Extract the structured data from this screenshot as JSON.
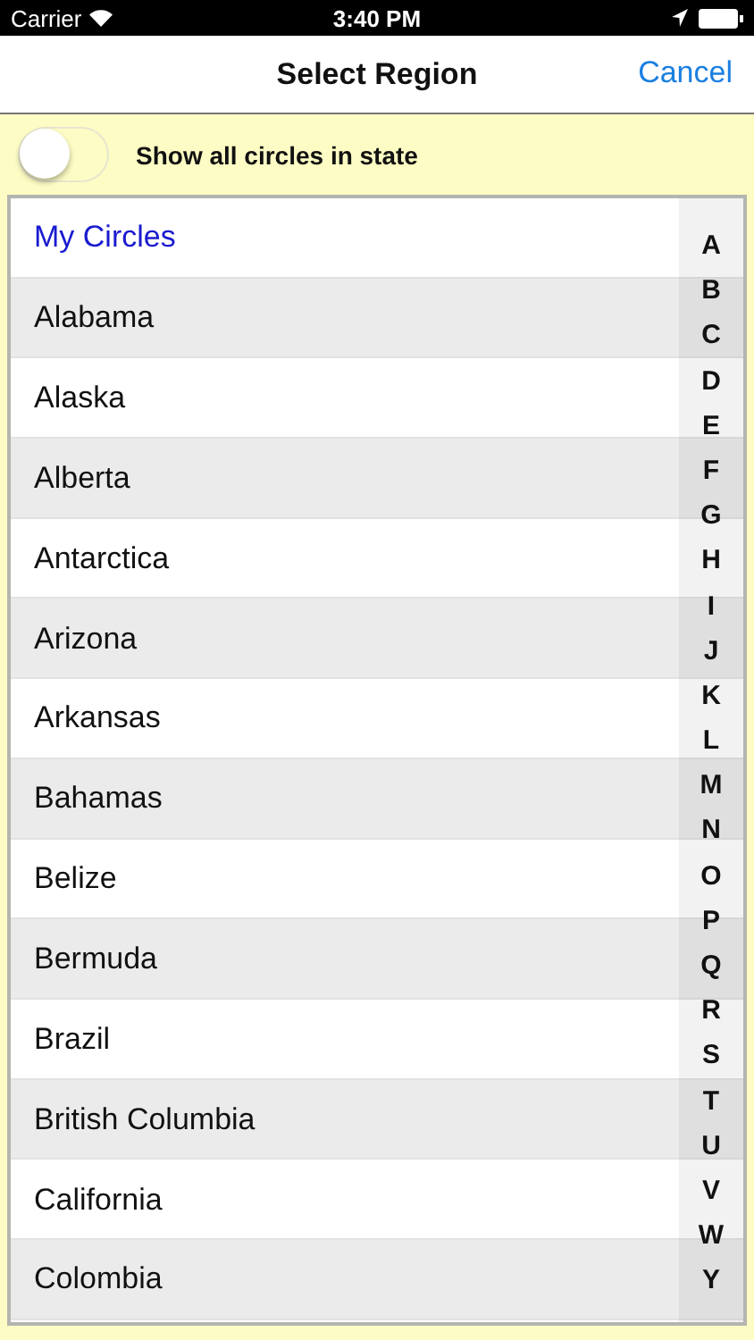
{
  "status_bar": {
    "carrier": "Carrier",
    "time": "3:40 PM"
  },
  "nav": {
    "title": "Select Region",
    "action": "Cancel"
  },
  "filter": {
    "label": "Show all circles in state",
    "on": false
  },
  "regions": [
    {
      "name": "My Circles",
      "kind": "header"
    },
    {
      "name": "Alabama",
      "kind": "region"
    },
    {
      "name": "Alaska",
      "kind": "region"
    },
    {
      "name": "Alberta",
      "kind": "region"
    },
    {
      "name": "Antarctica",
      "kind": "region"
    },
    {
      "name": "Arizona",
      "kind": "region"
    },
    {
      "name": "Arkansas",
      "kind": "region"
    },
    {
      "name": "Bahamas",
      "kind": "region"
    },
    {
      "name": "Belize",
      "kind": "region"
    },
    {
      "name": "Bermuda",
      "kind": "region"
    },
    {
      "name": "Brazil",
      "kind": "region"
    },
    {
      "name": "British Columbia",
      "kind": "region"
    },
    {
      "name": "California",
      "kind": "region"
    },
    {
      "name": "Colombia",
      "kind": "region"
    }
  ],
  "index": [
    "A",
    "B",
    "C",
    "D",
    "E",
    "F",
    "G",
    "H",
    "I",
    "J",
    "K",
    "L",
    "M",
    "N",
    "O",
    "P",
    "Q",
    "R",
    "S",
    "T",
    "U",
    "V",
    "W",
    "Y"
  ]
}
